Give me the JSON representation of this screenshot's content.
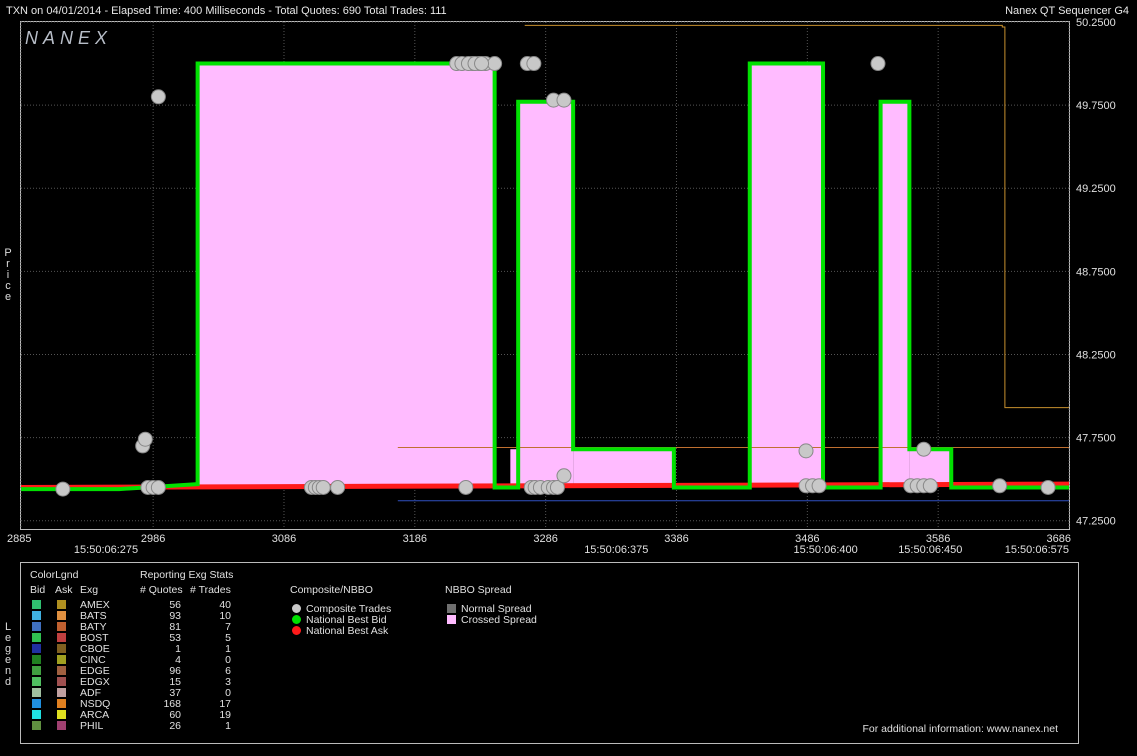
{
  "header": {
    "left": "TXN on 04/01/2014  -  Elapsed Time: 400 Milliseconds  -  Total Quotes: 690  Total Trades: 111",
    "right": "Nanex QT Sequencer G4"
  },
  "logo": "NANEX",
  "y_axis_title": "Price",
  "legend_title": "Legend",
  "chart_data": {
    "type": "line",
    "title": "TXN on 04/01/2014",
    "xlim": [
      2885,
      3686
    ],
    "ylim": [
      47.2,
      50.25
    ],
    "x_ticks": [
      "2885",
      "2986",
      "3086",
      "3186",
      "3286",
      "3386",
      "3486",
      "3586",
      "3686"
    ],
    "x_tick_values": [
      2885,
      2986,
      3086,
      3186,
      3286,
      3386,
      3486,
      3586,
      3686
    ],
    "time_labels": [
      {
        "x": 2950,
        "label": "15:50:06:275"
      },
      {
        "x": 3340,
        "label": "15:50:06:375"
      },
      {
        "x": 3500,
        "label": "15:50:06:400"
      },
      {
        "x": 3580,
        "label": "15:50:06:450"
      },
      {
        "x": 3650,
        "label": "15:50:06:575"
      }
    ],
    "y_ticks": [
      "50.2500",
      "49.7500",
      "49.2500",
      "48.7500",
      "48.2500",
      "47.7500",
      "47.2500"
    ],
    "y_tick_values": [
      50.25,
      49.75,
      49.25,
      48.75,
      48.25,
      47.75,
      47.25
    ],
    "crossed_spread_regions": [
      {
        "x0": 3020,
        "x1": 3247,
        "top": 50.0
      },
      {
        "x0": 3265,
        "x1": 3307,
        "top": 49.77
      },
      {
        "x0": 3442,
        "x1": 3498,
        "top": 50.0
      },
      {
        "x0": 3542,
        "x1": 3564,
        "top": 49.77
      },
      {
        "x0": 3259,
        "x1": 3265,
        "top": 47.68
      },
      {
        "x0": 3307,
        "x1": 3384,
        "top": 47.68
      },
      {
        "x0": 3564,
        "x1": 3596,
        "top": 47.68
      }
    ],
    "series": [
      {
        "name": "National Best Bid",
        "color": "#00e000",
        "x": [
          2885,
          2960,
          3020,
          3020,
          3247,
          3247,
          3265,
          3265,
          3307,
          3307,
          3384,
          3384,
          3442,
          3442,
          3498,
          3498,
          3542,
          3542,
          3564,
          3564,
          3596,
          3596,
          3686
        ],
        "y": [
          47.44,
          47.44,
          47.47,
          50.0,
          50.0,
          47.45,
          47.45,
          49.77,
          49.77,
          47.68,
          47.68,
          47.45,
          47.45,
          50.0,
          50.0,
          47.45,
          47.45,
          49.77,
          49.77,
          47.68,
          47.68,
          47.45,
          47.45
        ]
      },
      {
        "name": "National Best Ask",
        "color": "#ff1a1a",
        "x": [
          2885,
          3686
        ],
        "y": [
          47.45,
          47.47
        ]
      }
    ],
    "trade_points": {
      "x": [
        2917,
        2990,
        2978,
        2980,
        2982,
        2986,
        2990,
        3107,
        3110,
        3113,
        3116,
        3127,
        3225,
        3230,
        3235,
        3240,
        3247,
        3275,
        3278,
        3282,
        3288,
        3292,
        3295,
        3300,
        3218,
        3222,
        3227,
        3232,
        3237,
        3272,
        3277,
        3292,
        3300,
        3485,
        3490,
        3495,
        3485,
        3540,
        3565,
        3570,
        3575,
        3580,
        3575,
        3633,
        3670
      ],
      "y": [
        47.44,
        49.8,
        47.7,
        47.74,
        47.45,
        47.45,
        47.45,
        47.45,
        47.45,
        47.45,
        47.45,
        47.45,
        47.45,
        50.0,
        50.0,
        50.0,
        50.0,
        47.45,
        47.45,
        47.45,
        47.45,
        47.45,
        47.45,
        47.52,
        50.0,
        50.0,
        50.0,
        50.0,
        50.0,
        50.0,
        50.0,
        49.78,
        49.78,
        47.46,
        47.46,
        47.46,
        47.67,
        50.0,
        47.46,
        47.46,
        47.46,
        47.46,
        47.68,
        47.46,
        47.45
      ]
    },
    "extra_lines": [
      {
        "color": "#c7902e",
        "x": [
          3270,
          3635,
          3635,
          3637,
          3637,
          3686
        ],
        "y": [
          50.23,
          50.23,
          50.22,
          50.22,
          47.93,
          47.93
        ]
      },
      {
        "color": "#c07030",
        "x": [
          3173,
          3686
        ],
        "y": [
          47.69,
          47.69
        ]
      },
      {
        "color": "#3050c0",
        "x": [
          3173,
          3686
        ],
        "y": [
          47.37,
          47.37
        ]
      }
    ]
  },
  "legend": {
    "colorlgnd_title": "ColorLgnd",
    "col_bid": "Bid",
    "col_ask": "Ask",
    "col_exg": "Exg",
    "stats_title": "Reporting Exg Stats",
    "col_quotes": "# Quotes",
    "col_trades": "# Trades",
    "exchanges": [
      {
        "name": "AMEX",
        "quotes": "56",
        "trades": "40",
        "bid_color": "#30c070",
        "ask_color": "#b09020"
      },
      {
        "name": "BATS",
        "quotes": "93",
        "trades": "10",
        "bid_color": "#40b0e0",
        "ask_color": "#e09040"
      },
      {
        "name": "BATY",
        "quotes": "81",
        "trades": "7",
        "bid_color": "#4070c0",
        "ask_color": "#c06030"
      },
      {
        "name": "BOST",
        "quotes": "53",
        "trades": "5",
        "bid_color": "#30c050",
        "ask_color": "#c04040"
      },
      {
        "name": "CBOE",
        "quotes": "1",
        "trades": "1",
        "bid_color": "#2030a0",
        "ask_color": "#806020"
      },
      {
        "name": "CINC",
        "quotes": "4",
        "trades": "0",
        "bid_color": "#208020",
        "ask_color": "#a0a020"
      },
      {
        "name": "EDGE",
        "quotes": "96",
        "trades": "6",
        "bid_color": "#40a040",
        "ask_color": "#a06040"
      },
      {
        "name": "EDGX",
        "quotes": "15",
        "trades": "3",
        "bid_color": "#50c060",
        "ask_color": "#a05050"
      },
      {
        "name": "ADF",
        "quotes": "37",
        "trades": "0",
        "bid_color": "#a0c0a0",
        "ask_color": "#c0a0a0"
      },
      {
        "name": "NSDQ",
        "quotes": "168",
        "trades": "17",
        "bid_color": "#2090e0",
        "ask_color": "#e08020"
      },
      {
        "name": "ARCA",
        "quotes": "60",
        "trades": "19",
        "bid_color": "#20e0e0",
        "ask_color": "#e0e020"
      },
      {
        "name": "PHIL",
        "quotes": "26",
        "trades": "1",
        "bid_color": "#609040",
        "ask_color": "#a04070"
      }
    ],
    "composite_title": "Composite/NBBO",
    "composite_items": [
      {
        "label": "Composite Trades",
        "color": "#c8c8c8"
      },
      {
        "label": "National Best Bid",
        "color": "#00e000"
      },
      {
        "label": "National Best Ask",
        "color": "#ff1a1a"
      }
    ],
    "spread_title": "NBBO Spread",
    "spread_items": [
      {
        "label": "Normal Spread",
        "color": "#707070"
      },
      {
        "label": "Crossed Spread",
        "color": "#ffbbff"
      }
    ],
    "footer": "For additional information: www.nanex.net"
  }
}
